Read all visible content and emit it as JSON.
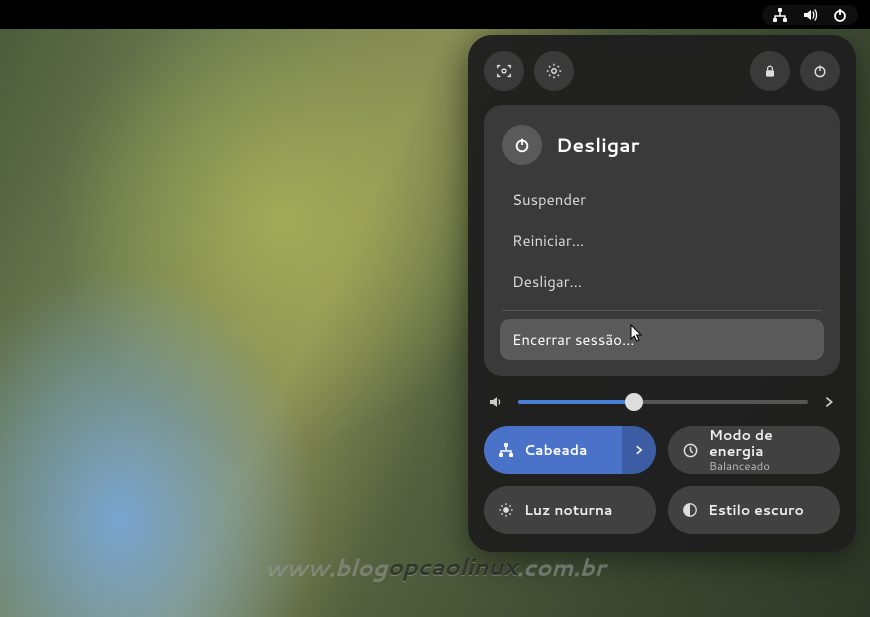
{
  "panel": {
    "power": {
      "title": "Desligar",
      "items": {
        "suspend": "Suspender",
        "restart": "Reiniciar…",
        "shutdown": "Desligar…",
        "logout": "Encerrar sessão…"
      }
    },
    "volume": {
      "percent": 40
    },
    "toggles": {
      "wired": {
        "label": "Cabeada"
      },
      "power_mode": {
        "label": "Modo de energia",
        "sub": "Balanceado"
      },
      "night_light": {
        "label": "Luz noturna"
      },
      "dark_style": {
        "label": "Estilo escuro"
      }
    }
  },
  "watermark": {
    "prefix": "www.blog",
    "emph": "opcaolinux",
    "suffix": ".com.br"
  }
}
